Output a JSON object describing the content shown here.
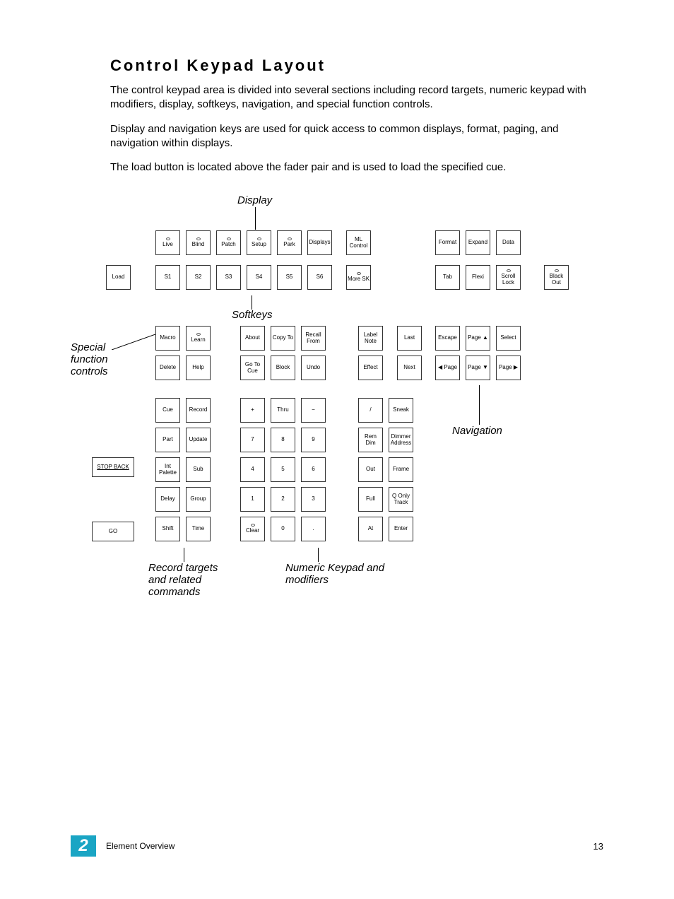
{
  "title": "Control Keypad Layout",
  "para1": "The control keypad area is divided into several sections including record targets, numeric keypad with modifiers, display, softkeys, navigation, and special function controls.",
  "para2": "Display and navigation keys are used for quick access to common displays, format, paging, and navigation within displays.",
  "para3": "The load button is located above the fader pair and is used to load the specified cue.",
  "callouts": {
    "display": "Display",
    "softkeys": "Softkeys",
    "special": "Special function controls",
    "navigation": "Navigation",
    "record": "Record targets and related commands",
    "numeric": "Numeric Keypad and modifiers"
  },
  "keys": {
    "load": "Load",
    "live": "Live",
    "blind": "Blind",
    "patch": "Patch",
    "setup": "Setup",
    "park": "Park",
    "displays": "Displays",
    "mlcontrol": "ML Control",
    "s1": "S1",
    "s2": "S2",
    "s3": "S3",
    "s4": "S4",
    "s5": "S5",
    "s6": "S6",
    "moresk": "More SK",
    "format": "Format",
    "expand": "Expand",
    "data": "Data",
    "tab": "Tab",
    "flexi": "Flexi",
    "scrolllock": "Scroll Lock",
    "blackout": "Black Out",
    "macro": "Macro",
    "learn": "Learn",
    "about": "About",
    "copyto": "Copy To",
    "recallfrom": "Recall From",
    "labelnote": "Label Note",
    "last": "Last",
    "delete": "Delete",
    "help": "Help",
    "gotocue": "Go To Cue",
    "block": "Block",
    "undo": "Undo",
    "effect": "Effect",
    "next": "Next",
    "escape": "Escape",
    "pageup": "Page ▲",
    "select": "Select",
    "pageleft": "◀ Page",
    "pagedown": "Page ▼",
    "pageright": "Page ▶",
    "cue": "Cue",
    "record": "Record",
    "part": "Part",
    "update": "Update",
    "intpalette": "Int Palette",
    "sub": "Sub",
    "delay": "Delay",
    "group": "Group",
    "shift": "Shift",
    "time": "Time",
    "plus": "+",
    "thru": "Thru",
    "minus": "−",
    "slash": "/",
    "sneak": "Sneak",
    "k7": "7",
    "k8": "8",
    "k9": "9",
    "remdim": "Rem Dim",
    "dimmeraddress": "Dimmer Address",
    "k4": "4",
    "k5": "5",
    "k6": "6",
    "out": "Out",
    "frame": "Frame",
    "k1": "1",
    "k2": "2",
    "k3": "3",
    "full": "Full",
    "qonlytrack": "Q Only Track",
    "clear": "Clear",
    "k0": "0",
    "dot": ".",
    "at": "At",
    "enter": "Enter",
    "stopback": "STOP BACK",
    "go": "GO"
  },
  "footer": {
    "chapter_num": "2",
    "section": "Element Overview",
    "page": "13"
  }
}
